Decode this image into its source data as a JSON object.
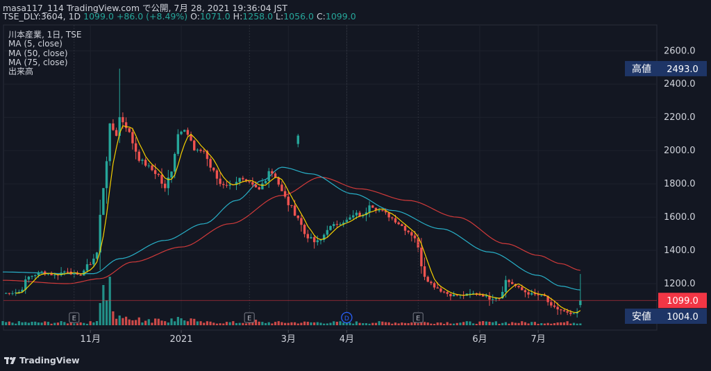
{
  "header": {
    "line1": "masa117_114 TradingView.com で公開, 7月 28, 2021 19:36:04 JST",
    "symbol": "TSE_DLY:3604, 1D",
    "close_val": "1099.0",
    "change": "+86.0 (+8.49%)",
    "o_label": "O:",
    "o_val": "1071.0",
    "h_label": "H:",
    "h_val": "1258.0",
    "l_label": "L:",
    "l_val": "1056.0",
    "c_label": "C:",
    "c_val": "1099.0"
  },
  "legend": {
    "title": "川本産業, 1日, TSE",
    "ma5": "MA (5, close)",
    "ma50": "MA (50, close)",
    "ma75": "MA (75, close)",
    "volume": "出来高"
  },
  "markers": {
    "earnings": "E",
    "dividend": "D"
  },
  "tags": {
    "high_label": "高値",
    "high_value": "2493.0",
    "low_label": "安値",
    "low_value": "1004.0",
    "last_value": "1099.0"
  },
  "footer": {
    "brand": "TradingView",
    "logo": "tradingview-logo-icon"
  },
  "colors": {
    "background": "#131722",
    "up": "#26a69a",
    "down": "#ef5350",
    "ma5": "#f5d000",
    "ma50": "#28b0c8",
    "ma75": "#d13a3a",
    "tag_bg": "#1e3566",
    "last_tag": "#f23645"
  },
  "chart_data": {
    "type": "candlestick",
    "ylim": [
      1004,
      2740
    ],
    "y_ticks": [
      "1200.0",
      "1400.0",
      "1600.0",
      "1800.0",
      "2000.0",
      "2200.0",
      "2400.0",
      "2600.0"
    ],
    "x_labels": [
      "11月",
      "2021",
      "3月",
      "4月",
      "6月",
      "7月"
    ],
    "days_total": 199,
    "month_label_days": [
      27,
      55,
      88,
      106,
      147,
      165
    ],
    "earnings_days": [
      22,
      76,
      128
    ],
    "dividend_days": [
      106
    ],
    "anchors": [
      [
        0,
        1140
      ],
      [
        5,
        1150
      ],
      [
        8,
        1240
      ],
      [
        12,
        1270
      ],
      [
        16,
        1250
      ],
      [
        20,
        1280
      ],
      [
        23,
        1240
      ],
      [
        26,
        1300
      ],
      [
        29,
        1380
      ],
      [
        31,
        1800
      ],
      [
        33,
        2150
      ],
      [
        35,
        2100
      ],
      [
        36,
        2200
      ],
      [
        38,
        2150
      ],
      [
        40,
        2050
      ],
      [
        42,
        1950
      ],
      [
        45,
        1900
      ],
      [
        48,
        1850
      ],
      [
        50,
        1760
      ],
      [
        52,
        1900
      ],
      [
        54,
        2100
      ],
      [
        56,
        2150
      ],
      [
        59,
        2000
      ],
      [
        62,
        2000
      ],
      [
        64,
        1900
      ],
      [
        67,
        1800
      ],
      [
        70,
        1790
      ],
      [
        73,
        1830
      ],
      [
        76,
        1800
      ],
      [
        79,
        1760
      ],
      [
        82,
        1880
      ],
      [
        84,
        1850
      ],
      [
        86,
        1750
      ],
      [
        88,
        1680
      ],
      [
        91,
        1600
      ],
      [
        93,
        1500
      ],
      [
        96,
        1450
      ],
      [
        98,
        1460
      ],
      [
        100,
        1530
      ],
      [
        103,
        1560
      ],
      [
        106,
        1580
      ],
      [
        109,
        1620
      ],
      [
        111,
        1600
      ],
      [
        113,
        1680
      ],
      [
        115,
        1650
      ],
      [
        118,
        1620
      ],
      [
        121,
        1580
      ],
      [
        124,
        1530
      ],
      [
        127,
        1480
      ],
      [
        128,
        1400
      ],
      [
        130,
        1250
      ],
      [
        132,
        1200
      ],
      [
        135,
        1160
      ],
      [
        138,
        1130
      ],
      [
        142,
        1130
      ],
      [
        145,
        1140
      ],
      [
        148,
        1130
      ],
      [
        150,
        1110
      ],
      [
        153,
        1120
      ],
      [
        155,
        1220
      ],
      [
        157,
        1200
      ],
      [
        159,
        1170
      ],
      [
        162,
        1140
      ],
      [
        165,
        1130
      ],
      [
        167,
        1120
      ],
      [
        169,
        1060
      ],
      [
        172,
        1040
      ],
      [
        175,
        1010
      ],
      [
        177,
        1030
      ]
    ],
    "last_candle": {
      "day": 178,
      "open": 1071.0,
      "high": 1258.0,
      "low": 1056.0,
      "close": 1099.0
    },
    "high_point": {
      "day": 36,
      "value": 2493.0
    },
    "gap_up": {
      "day": 91,
      "open": 2040,
      "close": 2090,
      "high": 2100,
      "low": 2020
    },
    "volume_spikes": [
      [
        30,
        32
      ],
      [
        31,
        58
      ],
      [
        32,
        36
      ],
      [
        33,
        70
      ],
      [
        34,
        20
      ],
      [
        36,
        14
      ],
      [
        54,
        12
      ],
      [
        55,
        10
      ],
      [
        78,
        8
      ]
    ],
    "ma5_seed": [
      1140,
      1145,
      1150
    ],
    "ma50_points": [
      [
        0,
        1270
      ],
      [
        20,
        1260
      ],
      [
        28,
        1260
      ],
      [
        36,
        1350
      ],
      [
        50,
        1460
      ],
      [
        62,
        1560
      ],
      [
        72,
        1700
      ],
      [
        80,
        1820
      ],
      [
        86,
        1900
      ],
      [
        95,
        1860
      ],
      [
        108,
        1740
      ],
      [
        120,
        1640
      ],
      [
        135,
        1530
      ],
      [
        150,
        1390
      ],
      [
        165,
        1250
      ],
      [
        172,
        1185
      ],
      [
        178,
        1162
      ]
    ],
    "ma75_points": [
      [
        0,
        1220
      ],
      [
        20,
        1200
      ],
      [
        30,
        1230
      ],
      [
        40,
        1330
      ],
      [
        55,
        1420
      ],
      [
        70,
        1560
      ],
      [
        86,
        1730
      ],
      [
        98,
        1840
      ],
      [
        110,
        1770
      ],
      [
        125,
        1700
      ],
      [
        140,
        1600
      ],
      [
        155,
        1440
      ],
      [
        165,
        1370
      ],
      [
        172,
        1320
      ],
      [
        178,
        1280
      ]
    ]
  }
}
